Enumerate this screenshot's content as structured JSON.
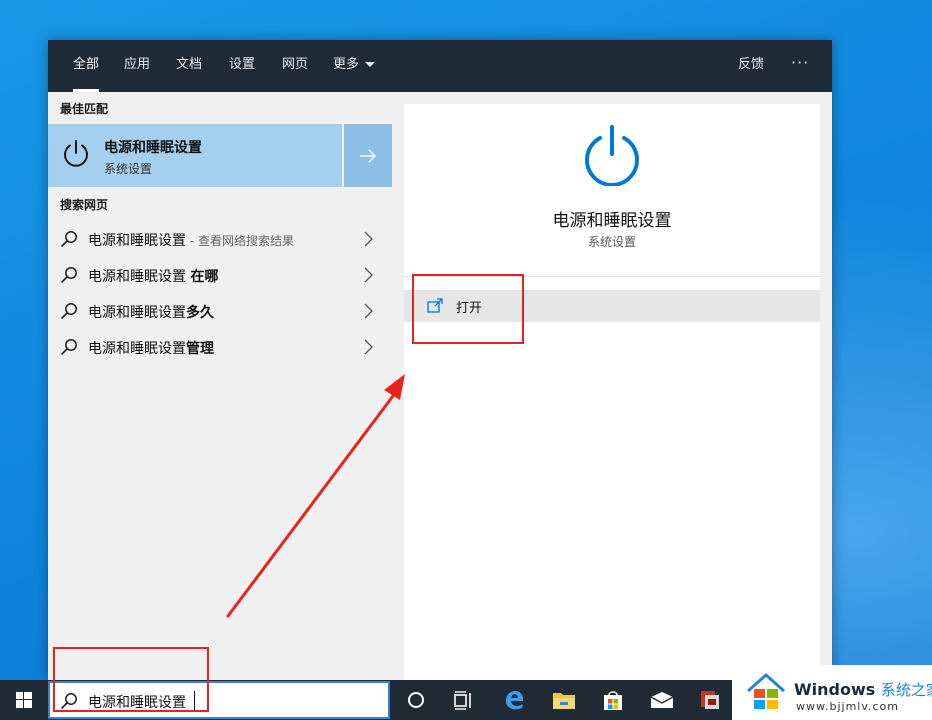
{
  "filterbar": {
    "tabs": [
      {
        "label": "全部"
      },
      {
        "label": "应用"
      },
      {
        "label": "文档"
      },
      {
        "label": "设置"
      },
      {
        "label": "网页"
      },
      {
        "label": "更多"
      }
    ],
    "active_tab": "全部",
    "feedback_label": "反馈",
    "more_options_label": "···"
  },
  "results": {
    "best_match_heading": "最佳匹配",
    "best_match": {
      "title": "电源和睡眠设置",
      "subtitle": "系统设置",
      "icon": "power-icon"
    },
    "web_heading": "搜索网页",
    "web_items": [
      {
        "query": "电源和睡眠设置",
        "hint": " - 查看网络搜索结果"
      },
      {
        "prefix": "电源和睡眠设置 ",
        "suffix": "在哪"
      },
      {
        "prefix": "电源和睡眠设置",
        "suffix": "多久"
      },
      {
        "prefix": "电源和睡眠设置",
        "suffix": "管理"
      }
    ]
  },
  "preview": {
    "title": "电源和睡眠设置",
    "subtitle": "系统设置",
    "icon": "power-icon",
    "actions": [
      {
        "label": "打开",
        "icon": "open-external-icon"
      }
    ]
  },
  "taskbar": {
    "search_value": "电源和睡眠设置",
    "icons": [
      "windows-start-icon",
      "cortana-icon",
      "task-view-icon",
      "edge-icon",
      "file-explorer-icon",
      "store-icon",
      "mail-icon",
      "app-icon"
    ]
  },
  "watermark": {
    "brand": "Windows",
    "brand_suffix": "系统之家",
    "url": "www.bjjmlv.com"
  },
  "colors": {
    "accent": "#0078d7",
    "best_match_bg": "#a5cfee",
    "annotation_red": "#e6231d",
    "filterbar_bg": "#1f2b37"
  }
}
